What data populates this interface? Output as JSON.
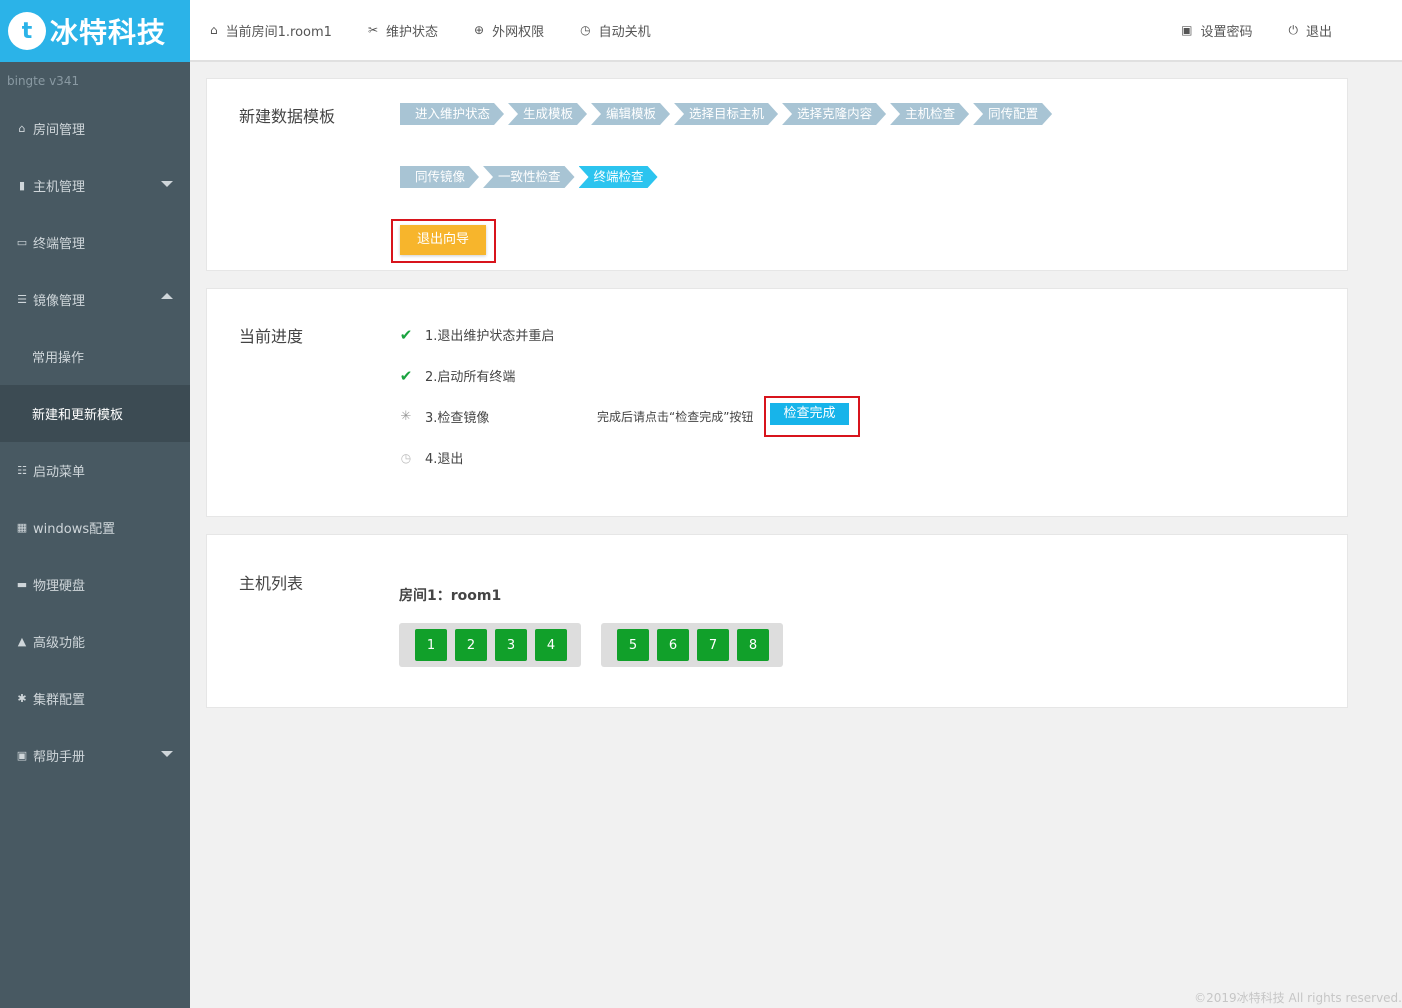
{
  "brand": {
    "logo_letter": "t",
    "name": "冰特科技",
    "version": "bingte  v341"
  },
  "sidebar": {
    "items": [
      {
        "label": "房间管理",
        "icon": "home-icon"
      },
      {
        "label": "主机管理",
        "icon": "server-icon",
        "expand": "down"
      },
      {
        "label": "终端管理",
        "icon": "monitor-icon"
      },
      {
        "label": "镜像管理",
        "icon": "database-icon",
        "expand": "up"
      },
      {
        "label": "常用操作",
        "sub": true
      },
      {
        "label": "新建和更新模板",
        "sub": true,
        "active": true
      },
      {
        "label": "启动菜单",
        "icon": "list-icon"
      },
      {
        "label": "windows配置",
        "icon": "windows-icon"
      },
      {
        "label": "物理硬盘",
        "icon": "harddisk-icon"
      },
      {
        "label": "高级功能",
        "icon": "warning-icon"
      },
      {
        "label": "集群配置",
        "icon": "gear-icon"
      },
      {
        "label": "帮助手册",
        "icon": "book-icon",
        "expand": "down"
      }
    ]
  },
  "topbar": {
    "current_room": "当前房间1.room1",
    "maintenance": "维护状态",
    "internet": "外网权限",
    "auto_shutdown": "自动关机",
    "set_password": "设置密码",
    "logout": "退出"
  },
  "wizard": {
    "title": "新建数据模板",
    "steps_row1": [
      "进入维护状态",
      "生成模板",
      "编辑模板",
      "选择目标主机",
      "选择克隆内容",
      "主机检查",
      "同传配置"
    ],
    "steps_row2": [
      "同传镜像",
      "一致性检查",
      "终端检查"
    ],
    "current_step": "终端检查",
    "exit_button": "退出向导"
  },
  "progress": {
    "title": "当前进度",
    "items": [
      {
        "label": "1.退出维护状态并重启",
        "status": "done"
      },
      {
        "label": "2.启动所有终端",
        "status": "done"
      },
      {
        "label": "3.检查镜像",
        "status": "running"
      },
      {
        "label": "4.退出",
        "status": "pending"
      }
    ],
    "hint": "完成后请点击“检查完成”按钮",
    "check_done_button": "检查完成"
  },
  "hosts": {
    "title": "主机列表",
    "room_label": "房间1：room1",
    "groups": [
      [
        "1",
        "2",
        "3",
        "4"
      ],
      [
        "5",
        "6",
        "7",
        "8"
      ]
    ]
  },
  "footer": "©2019冰特科技 All rights reserved.",
  "colors": {
    "sidebar": "#485962",
    "brand": "#2bb3e8",
    "step": "#a8c4d4",
    "step_current": "#2cc4ef",
    "orange_button": "#f7b52c",
    "blue_button": "#17b4ea",
    "host": "#11a02a",
    "highlight": "#d8141c"
  }
}
